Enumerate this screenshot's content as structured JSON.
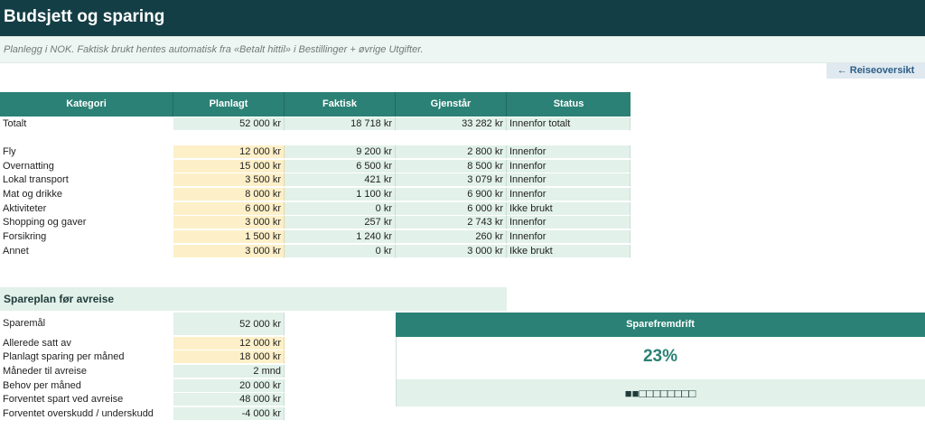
{
  "header": {
    "title": "Budsjett og sparing",
    "subtitle": "Planlegg i NOK. Faktisk brukt hentes automatisk fra «Betalt hittil» i Bestillinger + øvrige Utgifter.",
    "back_link": "← Reiseoversikt"
  },
  "budget": {
    "columns": [
      "Kategori",
      "Planlagt",
      "Faktisk",
      "Gjenstår",
      "Status"
    ],
    "total": {
      "label": "Totalt",
      "planned": "52 000 kr",
      "actual": "18 718 kr",
      "remaining": "33 282 kr",
      "status": "Innenfor totalt"
    },
    "rows": [
      {
        "label": "Fly",
        "planned": "12 000 kr",
        "actual": "9 200 kr",
        "remaining": "2 800 kr",
        "status": "Innenfor"
      },
      {
        "label": "Overnatting",
        "planned": "15 000 kr",
        "actual": "6 500 kr",
        "remaining": "8 500 kr",
        "status": "Innenfor"
      },
      {
        "label": "Lokal transport",
        "planned": "3 500 kr",
        "actual": "421 kr",
        "remaining": "3 079 kr",
        "status": "Innenfor"
      },
      {
        "label": "Mat og drikke",
        "planned": "8 000 kr",
        "actual": "1 100 kr",
        "remaining": "6 900 kr",
        "status": "Innenfor"
      },
      {
        "label": "Aktiviteter",
        "planned": "6 000 kr",
        "actual": "0 kr",
        "remaining": "6 000 kr",
        "status": "Ikke brukt"
      },
      {
        "label": "Shopping og gaver",
        "planned": "3 000 kr",
        "actual": "257 kr",
        "remaining": "2 743 kr",
        "status": "Innenfor"
      },
      {
        "label": "Forsikring",
        "planned": "1 500 kr",
        "actual": "1 240 kr",
        "remaining": "260 kr",
        "status": "Innenfor"
      },
      {
        "label": "Annet",
        "planned": "3 000 kr",
        "actual": "0 kr",
        "remaining": "3 000 kr",
        "status": "Ikke brukt"
      }
    ]
  },
  "savings": {
    "title": "Spareplan før avreise",
    "goal": {
      "label": "Sparemål",
      "value": "52 000 kr"
    },
    "rows": [
      {
        "label": "Allerede satt av",
        "value": "12 000 kr",
        "input": true
      },
      {
        "label": "Planlagt sparing per måned",
        "value": "18 000 kr",
        "input": true
      },
      {
        "label": "Måneder til avreise",
        "value": "2 mnd",
        "input": false
      },
      {
        "label": "Behov per måned",
        "value": "20 000 kr",
        "input": false
      },
      {
        "label": "Forventet spart ved avreise",
        "value": "48 000 kr",
        "input": false
      },
      {
        "label": "Forventet overskudd / underskudd",
        "value": "-4 000 kr",
        "input": false
      }
    ]
  },
  "progress": {
    "title": "Sparefremdrift",
    "percent_label": "23%",
    "percent": 23,
    "squares_filled": 2,
    "squares_total": 10,
    "squares_text": "■■□□□□□□□□"
  },
  "colors": {
    "title_bg": "#143e45",
    "accent": "#2b8175",
    "mint": "#e2f1ea",
    "input_yellow": "#fdf0c8"
  }
}
